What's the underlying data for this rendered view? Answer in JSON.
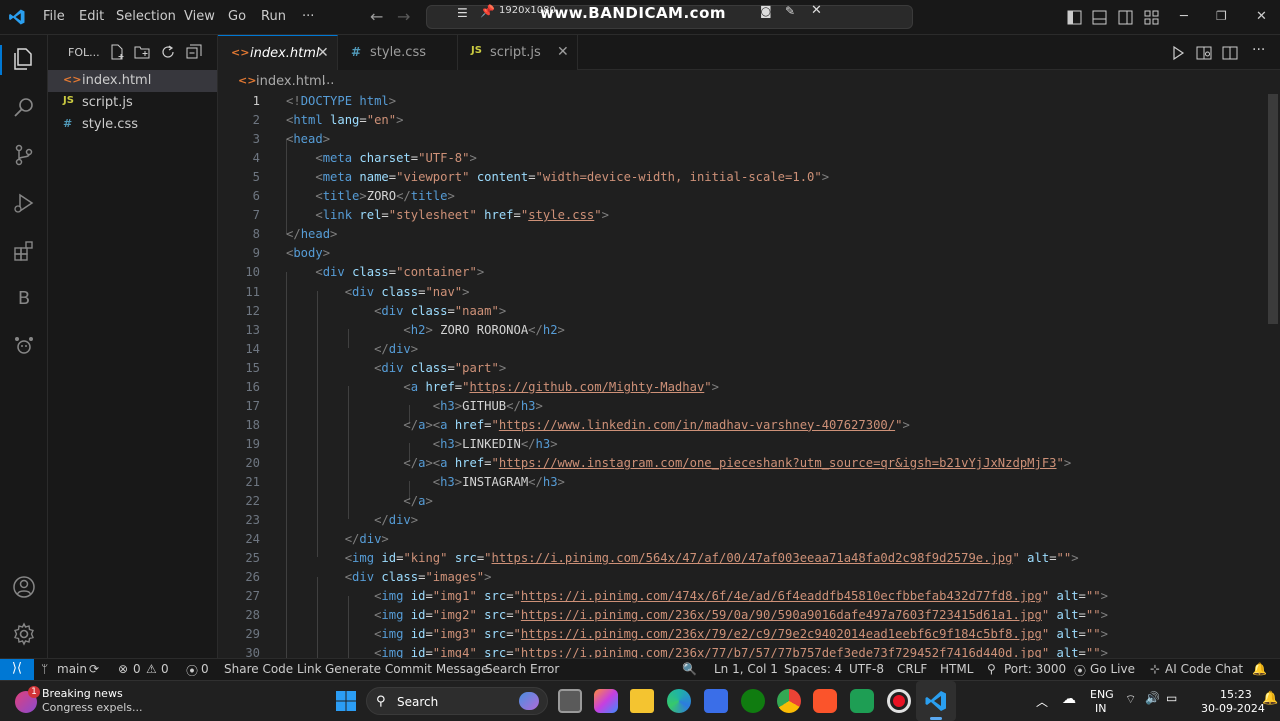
{
  "titlebar": {
    "menus": [
      "File",
      "Edit",
      "Selection",
      "View",
      "Go",
      "Run",
      "···"
    ],
    "recorder_resolution": "1920x1080",
    "recorder_watermark": "www.BANDICAM.com"
  },
  "sidebar": {
    "title": "FOL...",
    "files": [
      {
        "name": "index.html",
        "icon": "<>",
        "color": "#e37933"
      },
      {
        "name": "script.js",
        "icon": "JS",
        "color": "#cbcb41"
      },
      {
        "name": "style.css",
        "icon": "#",
        "color": "#519aba"
      }
    ]
  },
  "tabs": [
    {
      "name": "index.html",
      "icon": "<>",
      "color": "#e37933",
      "close": "✕"
    },
    {
      "name": "style.css",
      "icon": "#",
      "color": "#519aba",
      "close": ""
    },
    {
      "name": "script.js",
      "icon": "JS",
      "color": "#cbcb41",
      "close": "✕"
    }
  ],
  "breadcrumb": {
    "file": "index.html",
    "sep": "..."
  },
  "editor": {
    "line_numbers": [
      "1",
      "2",
      "3",
      "4",
      "5",
      "6",
      "7",
      "8",
      "9",
      "10",
      "11",
      "12",
      "13",
      "14",
      "15",
      "16",
      "17",
      "18",
      "19",
      "20",
      "21",
      "22",
      "23",
      "24",
      "25",
      "26",
      "27",
      "28",
      "29",
      "30"
    ],
    "lines": [
      "<!DOCTYPE html>",
      "<html lang=\"en\">",
      "<head>",
      "    <meta charset=\"UTF-8\">",
      "    <meta name=\"viewport\" content=\"width=device-width, initial-scale=1.0\">",
      "    <title>ZORO</title>",
      "    <link rel=\"stylesheet\" href=\"style.css\">",
      "</head>",
      "<body>",
      "    <div class=\"container\">",
      "        <div class=\"nav\">",
      "            <div class=\"naam\">",
      "                <h2> ZORO RORONOA</h2>",
      "            </div>",
      "            <div class=\"part\">",
      "                <a href=\"https://github.com/Mighty-Madhav\">",
      "                    <h3>GITHUB</h3>",
      "                </a><a href=\"https://www.linkedin.com/in/madhav-varshney-407627300/\">",
      "                    <h3>LINKEDIN</h3>",
      "                </a><a href=\"https://www.instagram.com/one_pieceshank?utm_source=qr&igsh=b21vYjJxNzdpMjF3\">",
      "                    <h3>INSTAGRAM</h3>",
      "                </a>",
      "            </div>",
      "        </div>",
      "        <img id=\"king\" src=\"https://i.pinimg.com/564x/47/af/00/47af003eeaa71a48fa0d2c98f9d2579e.jpg\" alt=\"\">",
      "        <div class=\"images\">",
      "            <img id=\"img1\" src=\"https://i.pinimg.com/474x/6f/4e/ad/6f4eaddfb45810ecfbbefab432d77fd8.jpg\" alt=\"\">",
      "            <img id=\"img2\" src=\"https://i.pinimg.com/236x/59/0a/90/590a9016dafe497a7603f723415d61a1.jpg\" alt=\"\">",
      "            <img id=\"img3\" src=\"https://i.pinimg.com/236x/79/e2/c9/79e2c9402014ead1eebf6c9f184c5bf8.jpg\" alt=\"\">",
      "            <img id=\"img4\" src=\"https://i.pinimg.com/236x/77/b7/57/77b757def3ede73f729452f7416d440d.jpg\" alt=\"\">"
    ]
  },
  "statusbar": {
    "branch": "main",
    "errors": "0",
    "warnings": "0",
    "ports_count": "0",
    "share_code_link": "Share Code Link",
    "generate_commit": "Generate Commit Message",
    "search_error": "Search Error",
    "cursor": "Ln 1, Col 1",
    "spaces": "Spaces: 4",
    "encoding": "UTF-8",
    "eol": "CRLF",
    "language": "HTML",
    "port": "Port: 3000",
    "go_live": "Go Live",
    "ai_chat": "AI Code Chat"
  },
  "taskbar": {
    "news_badge": "1",
    "news_title": "Breaking news",
    "news_subtitle": "Congress expels...",
    "search_label": "Search",
    "lang_top": "ENG",
    "lang_bottom": "IN",
    "time": "15:23",
    "date": "30-09-2024"
  }
}
